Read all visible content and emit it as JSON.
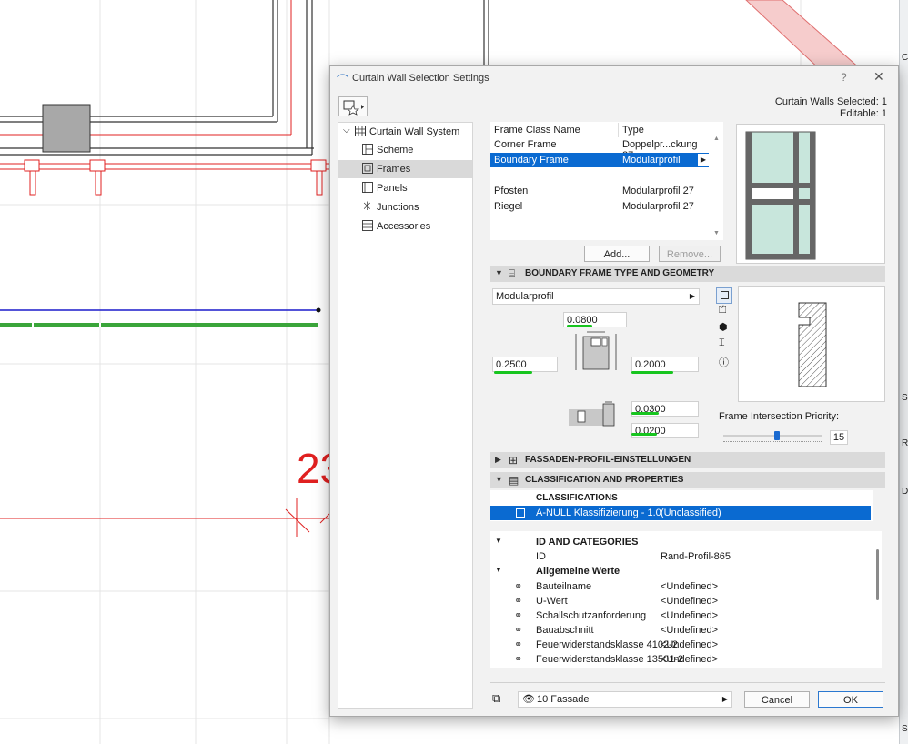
{
  "background": {
    "dimension_text": "23"
  },
  "right_strip": {
    "labels": [
      "C",
      "S",
      "R",
      "D",
      "S"
    ]
  },
  "dialog": {
    "title": "Curtain Wall Selection Settings",
    "help_label": "?",
    "close_label": "✕",
    "status_selected": "Curtain Walls Selected: 1",
    "status_editable": "Editable: 1",
    "tree": [
      {
        "label": "Curtain Wall System",
        "icon": "grid-icon"
      },
      {
        "label": "Scheme",
        "icon": "scheme-icon"
      },
      {
        "label": "Frames",
        "icon": "frame-icon",
        "selected": true
      },
      {
        "label": "Panels",
        "icon": "panel-icon"
      },
      {
        "label": "Junctions",
        "icon": "junction-icon"
      },
      {
        "label": "Accessories",
        "icon": "accessory-icon"
      }
    ],
    "frames": {
      "col_name": "Frame Class Name",
      "col_type": "Type",
      "rows": [
        {
          "name": "Corner Frame",
          "type": "Doppelpr...ckung 27"
        },
        {
          "name": "Boundary Frame",
          "type": "Modularprofil",
          "selected": true
        },
        {
          "name": "Pfosten",
          "type": "Modularprofil 27"
        },
        {
          "name": "Riegel",
          "type": "Modularprofil 27"
        }
      ],
      "add_label": "Add...",
      "remove_label": "Remove..."
    },
    "geometry": {
      "header": "BOUNDARY FRAME TYPE AND GEOMETRY",
      "type_value": "Modularprofil",
      "v_top": "0.0800",
      "v_left": "0.2500",
      "v_right": "0.2000",
      "v_offset1": "0.0300",
      "v_offset2": "0.0200",
      "priority_label": "Frame Intersection Priority:",
      "priority_value": "15",
      "priority_level": 0.55
    },
    "fassaden_header": "FASSADEN-PROFIL-EINSTELLUNGEN",
    "classification_header": "CLASSIFICATION AND PROPERTIES",
    "classifications_title": "CLASSIFICATIONS",
    "classification_row": {
      "name": "A-NULL Klassifizierung - 1.0",
      "value": "(Unclassified)"
    },
    "id_categories": "ID AND CATEGORIES",
    "id_key": "ID",
    "id_value": "Rand-Profil-865",
    "general_values": "Allgemeine Werte",
    "properties": [
      {
        "name": "Bauteilname",
        "value": "<Undefined>"
      },
      {
        "name": "U-Wert",
        "value": "<Undefined>"
      },
      {
        "name": "Schallschutzanforderung",
        "value": "<Undefined>"
      },
      {
        "name": "Bauabschnitt",
        "value": "<Undefined>"
      },
      {
        "name": "Feuerwiderstandsklasse 4102-2",
        "value": "<Undefined>"
      },
      {
        "name": "Feuerwiderstandsklasse 13501-2",
        "value": "<Undefined>"
      }
    ],
    "layer_value": "10 Fassade",
    "cancel_label": "Cancel",
    "ok_label": "OK"
  }
}
